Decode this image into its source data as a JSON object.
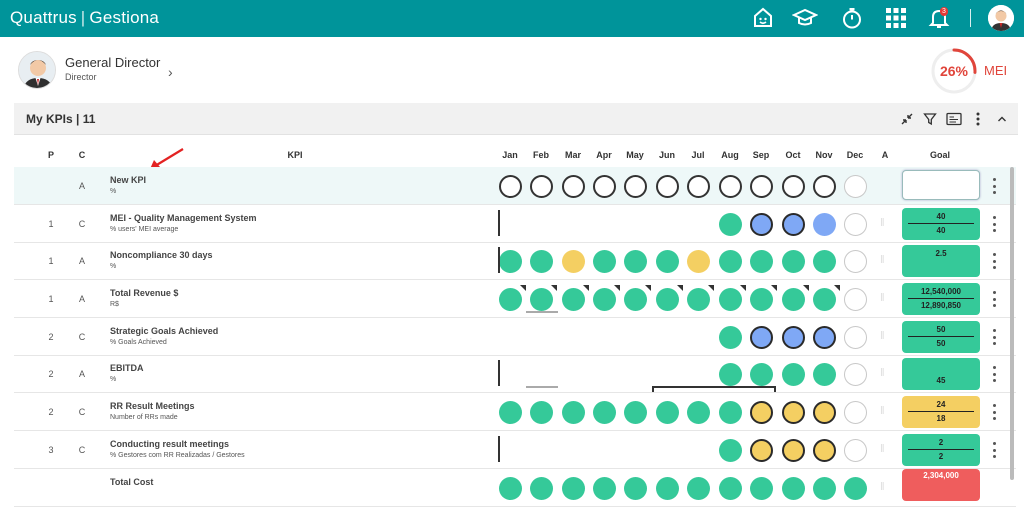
{
  "app": {
    "brand": "Quattrus",
    "section": "Gestiona",
    "notifications": "3"
  },
  "user": {
    "name": "General Director",
    "role": "Director"
  },
  "score": {
    "percent": "26%",
    "label": "MEI",
    "value": 0.26,
    "color": "#e0453b"
  },
  "panel": {
    "title": "My KPIs | 11"
  },
  "columns": {
    "p": "P",
    "c": "C",
    "kpi": "KPI",
    "a": "A",
    "goal": "Goal",
    "months": [
      "Jan",
      "Feb",
      "Mar",
      "Apr",
      "May",
      "Jun",
      "Jul",
      "Aug",
      "Sep",
      "Oct",
      "Nov",
      "Dec"
    ]
  },
  "colors": {
    "brand": "#00949a",
    "green": "#35c999",
    "yellow": "#f4cf62",
    "blue": "#7fa8f5",
    "red": "#ef5d5d"
  },
  "rows": [
    {
      "p": "",
      "c": "A",
      "name": "New KPI",
      "unit": "%"
    },
    {
      "p": "1",
      "c": "C",
      "name": "MEI - Quality Management System",
      "unit": "% users' MEI average",
      "goal1": "40",
      "goal2": "40"
    },
    {
      "p": "1",
      "c": "A",
      "name": "Noncompliance 30 days",
      "unit": "%",
      "goal1": "2.5"
    },
    {
      "p": "1",
      "c": "A",
      "name": "Total Revenue $",
      "unit": "R$",
      "goal1": "12,540,000",
      "goal2": "12,890,850"
    },
    {
      "p": "2",
      "c": "C",
      "name": "Strategic Goals Achieved",
      "unit": "% Goals Achieved",
      "goal1": "50",
      "goal2": "50"
    },
    {
      "p": "2",
      "c": "A",
      "name": "EBITDA",
      "unit": "%",
      "goal1": "45"
    },
    {
      "p": "2",
      "c": "C",
      "name": "RR Result Meetings",
      "unit": "Number of RRs made",
      "goal1": "24",
      "goal2": "18"
    },
    {
      "p": "3",
      "c": "C",
      "name": "Conducting result meetings",
      "unit": "% Gestores com RR Realizadas / Gestores",
      "goal1": "2",
      "goal2": "2"
    },
    {
      "p": "",
      "c": "",
      "name": "Total Cost",
      "unit": "",
      "goal1": "2,304,000"
    }
  ]
}
